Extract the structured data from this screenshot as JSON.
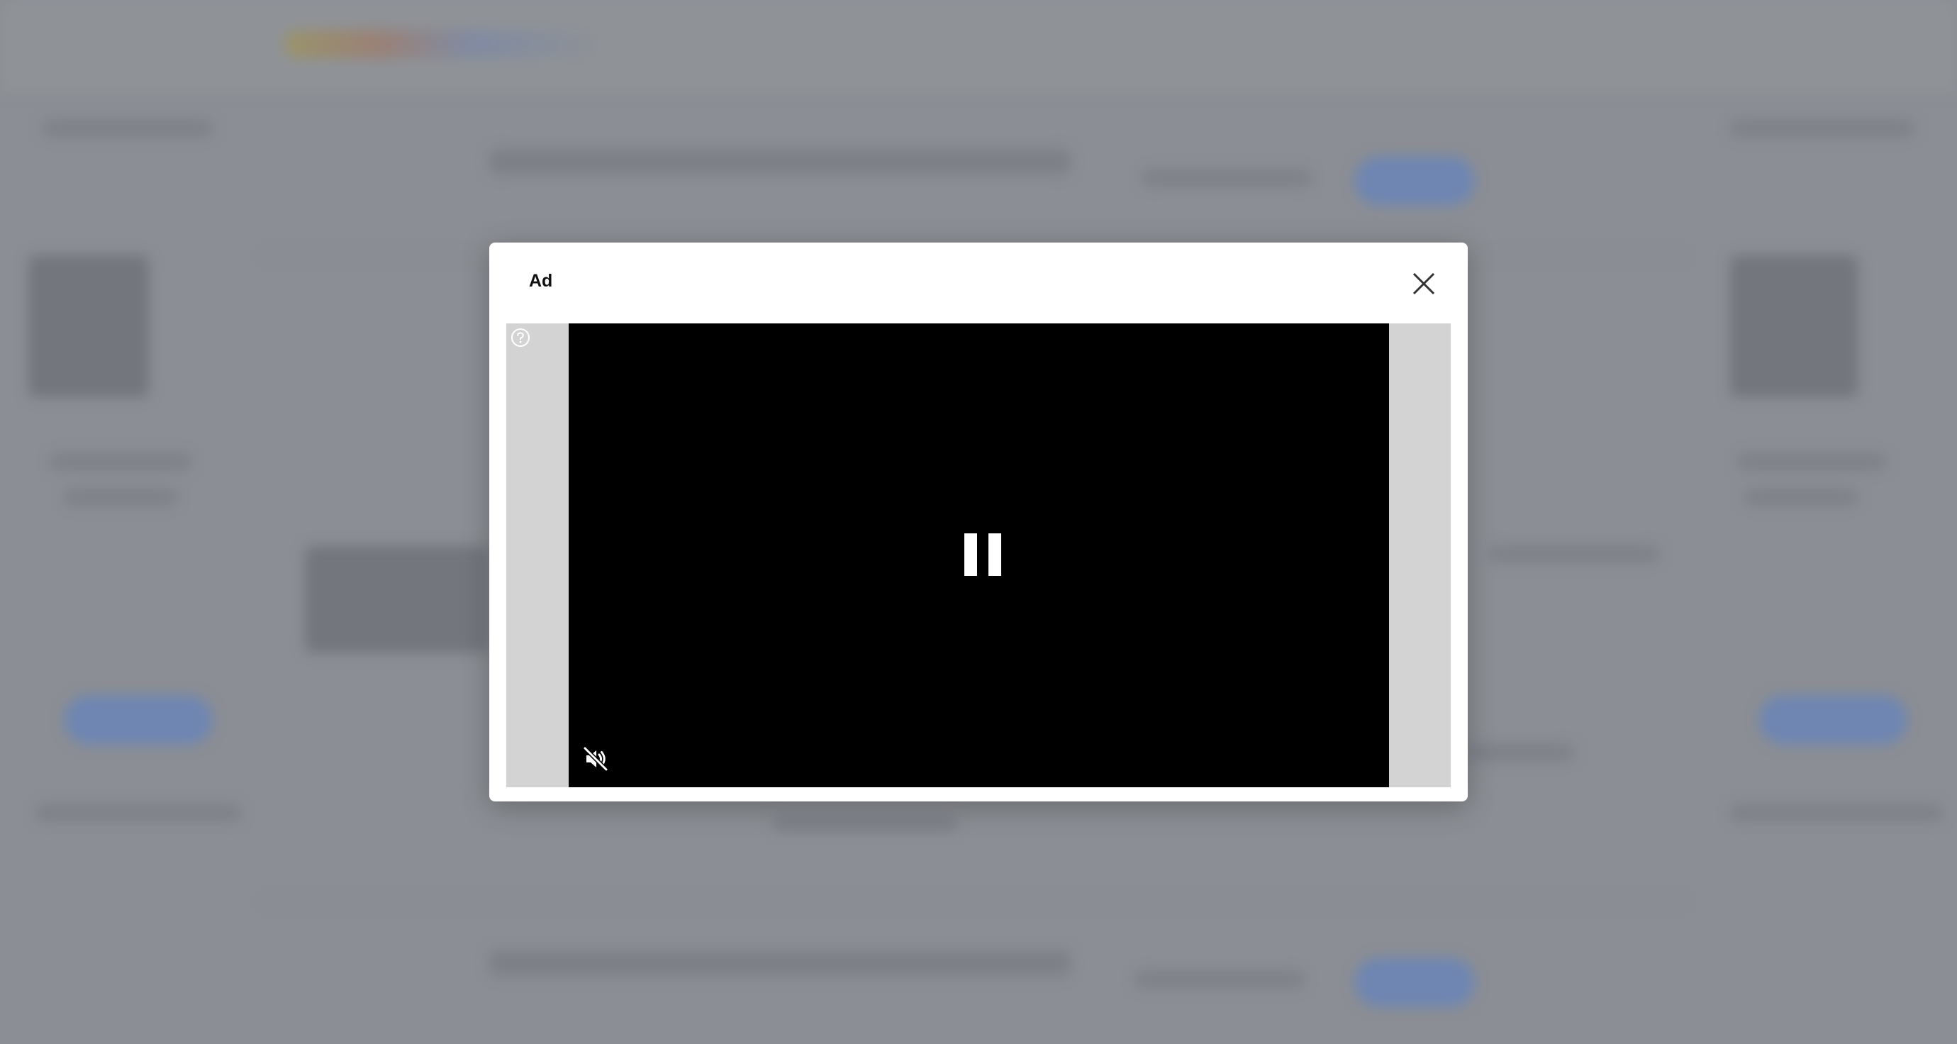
{
  "modal": {
    "title": "Ad",
    "close_icon": "close-icon",
    "help_icon": "question-circle-icon",
    "play_state_icon": "pause-icon",
    "mute_icon": "speaker-muted-icon"
  },
  "colors": {
    "overlay": "#8b8e94",
    "modal_bg": "#ffffff",
    "ad_frame_bg": "#d3d3d3",
    "video_bg": "#000000"
  }
}
